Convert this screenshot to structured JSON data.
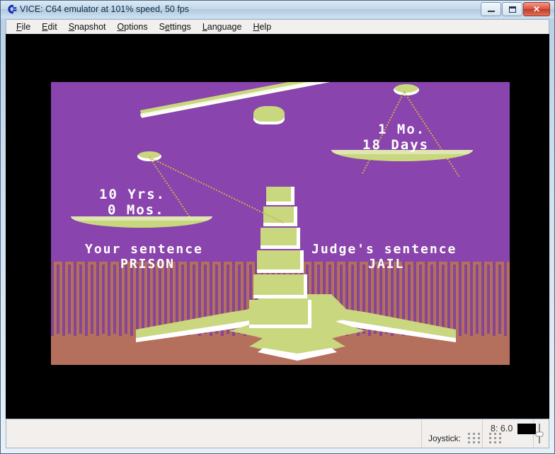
{
  "window": {
    "title": "VICE: C64 emulator at 101% speed, 50 fps",
    "icon": "commodore-logo-icon",
    "controls": {
      "minimize": "–",
      "maximize": "□",
      "close": "✕"
    }
  },
  "menu": {
    "items": [
      {
        "label": "File",
        "mnemonic": "F"
      },
      {
        "label": "Edit",
        "mnemonic": "E"
      },
      {
        "label": "Snapshot",
        "mnemonic": "S"
      },
      {
        "label": "Options",
        "mnemonic": "O"
      },
      {
        "label": "Settings",
        "mnemonic": "e"
      },
      {
        "label": "Language",
        "mnemonic": "L"
      },
      {
        "label": "Help",
        "mnemonic": "H"
      }
    ]
  },
  "emulator": {
    "border_color": "#000000",
    "background_color": "#8a44ad",
    "ground_color": "#b5705d",
    "object_color": "#c9d77e",
    "highlight_color": "#ffffff",
    "chain_color": "#c6b34a",
    "text_color": "#ffffff",
    "scene": {
      "left_pan": {
        "line1": "10 Yrs.",
        "line2": "0 Mos."
      },
      "right_pan": {
        "line1": "1 Mo.",
        "line2": "18 Days"
      },
      "left_caption": {
        "line1": "Your sentence",
        "line2": "PRISON"
      },
      "right_caption": {
        "line1": "Judge's sentence",
        "line2": "JAIL"
      }
    }
  },
  "statusbar": {
    "joystick_label": "Joystick:",
    "drive_status": "8: 6.0",
    "led_state": "off",
    "grip": "resize-grip"
  }
}
